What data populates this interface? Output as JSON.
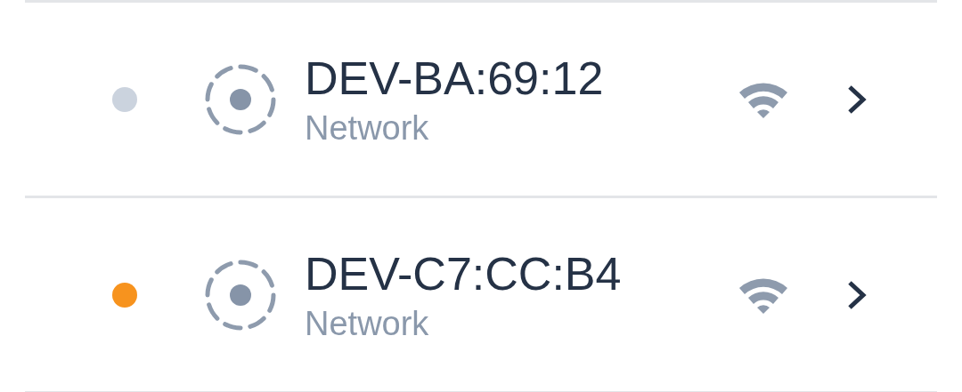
{
  "devices": [
    {
      "name": "DEV-BA:69:12",
      "type": "Network",
      "color": "#cbd3de"
    },
    {
      "name": "DEV-C7:CC:B4",
      "type": "Network",
      "color": "#f7931e"
    }
  ]
}
